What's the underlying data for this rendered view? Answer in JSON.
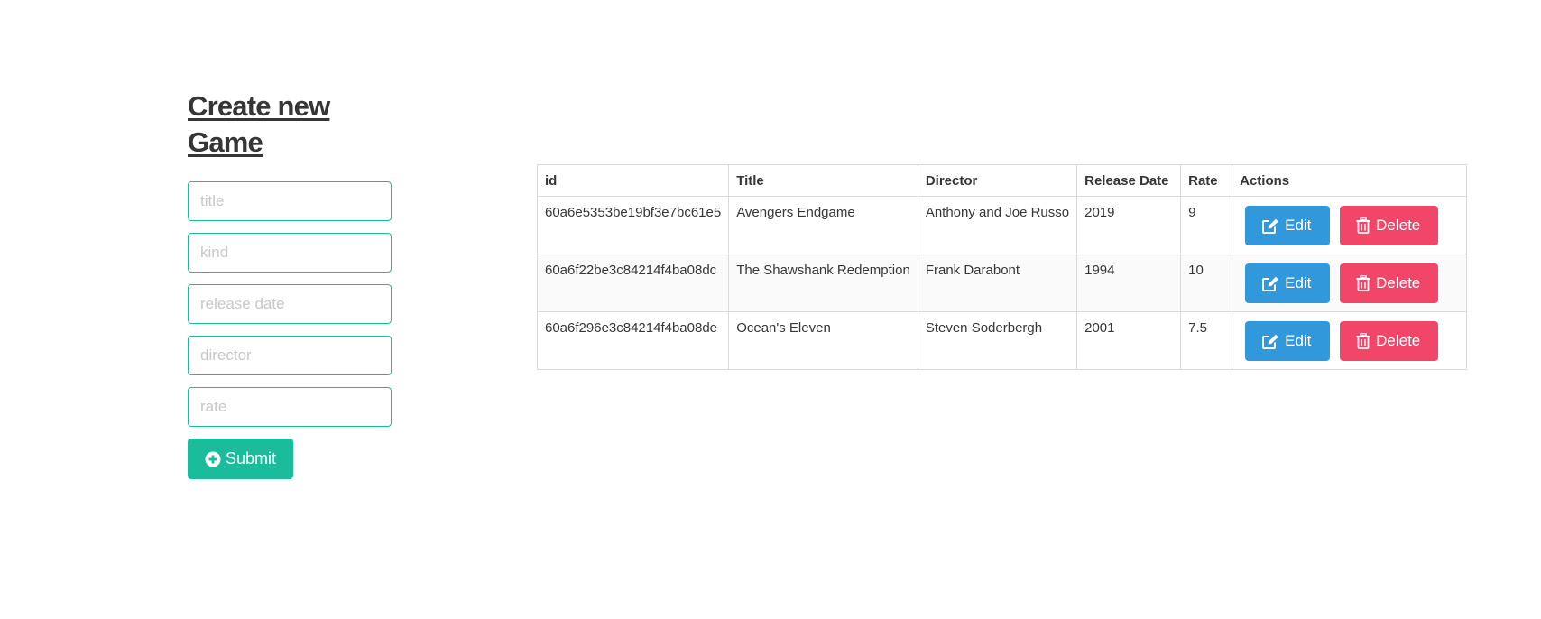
{
  "form": {
    "title": "Create new Game",
    "fields": [
      {
        "name": "title",
        "placeholder": "title",
        "value": ""
      },
      {
        "name": "kind",
        "placeholder": "kind",
        "value": ""
      },
      {
        "name": "release_date",
        "placeholder": "release date",
        "value": ""
      },
      {
        "name": "director",
        "placeholder": "director",
        "value": ""
      },
      {
        "name": "rate",
        "placeholder": "rate",
        "value": ""
      }
    ],
    "submit_label": "Submit",
    "submit_icon": "plus-circle-icon"
  },
  "table": {
    "headers": {
      "id": "id",
      "title": "Title",
      "director": "Director",
      "release_date": "Release Date",
      "rate": "Rate",
      "actions": "Actions"
    },
    "rows": [
      {
        "id": "60a6e5353be19bf3e7bc61e5",
        "title": "Avengers Endgame",
        "director": "Anthony and Joe Russo",
        "release_date": "2019",
        "rate": "9"
      },
      {
        "id": "60a6f22be3c84214f4ba08dc",
        "title": "The Shawshank Redemption",
        "director": "Frank Darabont",
        "release_date": "1994",
        "rate": "10"
      },
      {
        "id": "60a6f296e3c84214f4ba08de",
        "title": "Ocean's Eleven",
        "director": "Steven Soderbergh",
        "release_date": "2001",
        "rate": "7.5"
      }
    ],
    "edit_label": "Edit",
    "edit_icon": "edit-icon",
    "delete_label": "Delete",
    "delete_icon": "trash-icon"
  },
  "colors": {
    "primary": "#1abc9c",
    "info": "#3298dc",
    "danger": "#f14668",
    "text": "#363636",
    "placeholder": "#c8c8c8",
    "border": "#dbdbdb"
  }
}
